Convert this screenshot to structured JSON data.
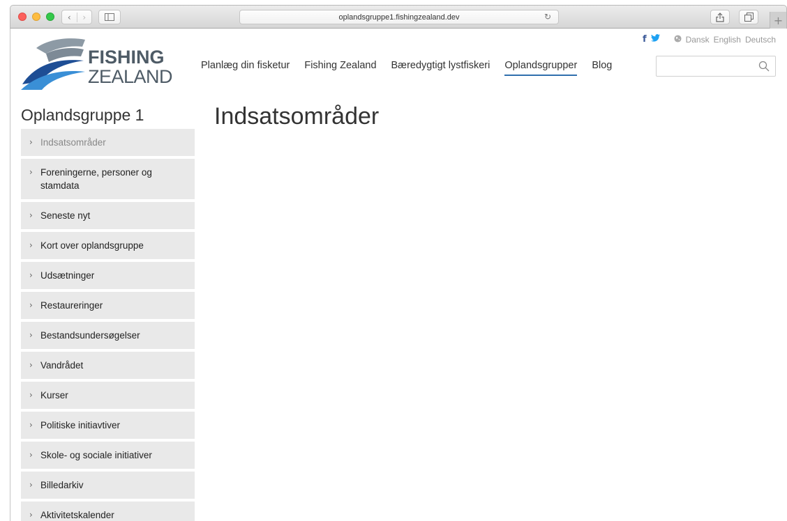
{
  "browser": {
    "nav_back": "‹",
    "nav_forward": "›",
    "url": "oplandsgruppe1.fishingzealand.dev",
    "reload": "↻",
    "new_tab": "+"
  },
  "logo": {
    "line1": "FISHING",
    "line2": "ZEALAND",
    "colors": {
      "fish": "#8d9aa5",
      "wave_dark": "#1e4e95",
      "wave_light": "#3a8fd6"
    }
  },
  "social": {
    "facebook": "f",
    "twitter": "🐦"
  },
  "languages": [
    "Dansk",
    "English",
    "Deutsch"
  ],
  "nav": {
    "items": [
      {
        "label": "Planlæg din fisketur"
      },
      {
        "label": "Fishing Zealand"
      },
      {
        "label": "Bæredygtigt lystfiskeri"
      },
      {
        "label": "Oplandsgrupper",
        "active": true
      },
      {
        "label": "Blog"
      }
    ]
  },
  "search": {
    "placeholder": ""
  },
  "sidebar": {
    "title": "Oplandsgruppe 1",
    "items": [
      {
        "label": "Indsatsområder",
        "active": true
      },
      {
        "label": "Foreningerne, personer og stamdata"
      },
      {
        "label": "Seneste nyt"
      },
      {
        "label": "Kort over oplandsgruppe"
      },
      {
        "label": "Udsætninger"
      },
      {
        "label": "Restaureringer"
      },
      {
        "label": "Bestandsundersøgelser"
      },
      {
        "label": "Vandrådet"
      },
      {
        "label": "Kurser"
      },
      {
        "label": "Politiske initiavtiver"
      },
      {
        "label": "Skole- og sociale initiativer"
      },
      {
        "label": "Billedarkiv"
      },
      {
        "label": "Aktivitetskalender"
      }
    ]
  },
  "main": {
    "heading": "Indsatsområder"
  },
  "colors": {
    "accent": "#2f6fad",
    "sidebar_bg": "#e9e9e9"
  }
}
